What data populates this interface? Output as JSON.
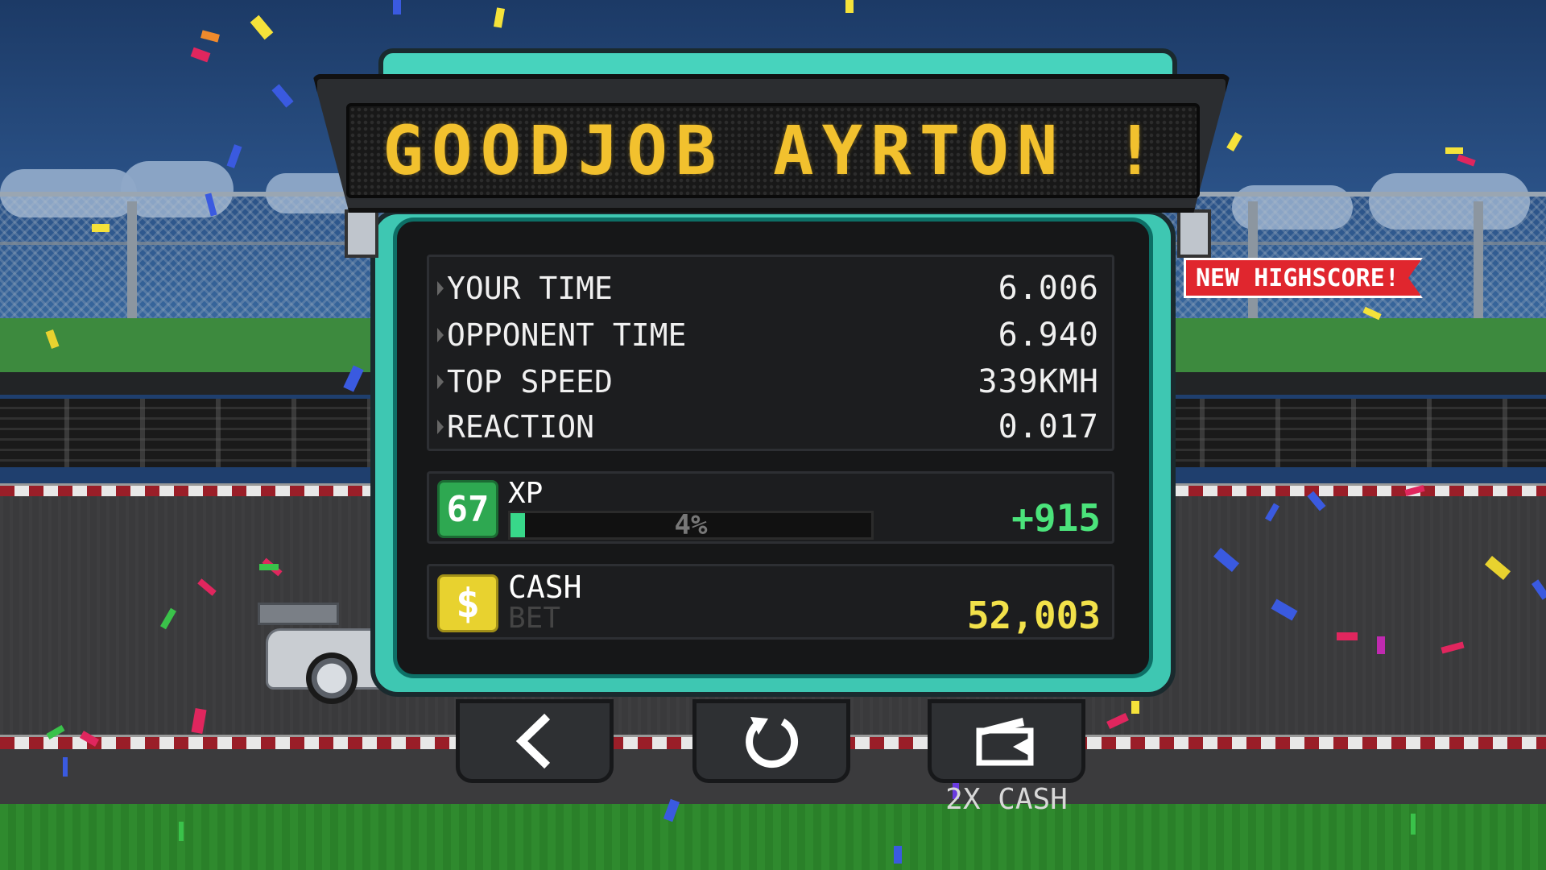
{
  "header": {
    "title": "GOODJOB AYRTON !"
  },
  "badge": {
    "label": "NEW HIGHSCORE!"
  },
  "stats": [
    {
      "label": "YOUR TIME",
      "value": "6.006"
    },
    {
      "label": "OPPONENT TIME",
      "value": "6.940"
    },
    {
      "label": "TOP SPEED",
      "value": "339KMH"
    },
    {
      "label": "REACTION",
      "value": "0.017"
    }
  ],
  "xp": {
    "level": "67",
    "label": "XP",
    "progress_percent": 4,
    "progress_text": "4%",
    "gain": "+915"
  },
  "cash": {
    "icon": "$",
    "label": "CASH",
    "sublabel": "BET",
    "value": "52,003"
  },
  "buttons": {
    "back_icon": "back-arrow-icon",
    "retry_icon": "retry-icon",
    "video_icon": "video-camera-icon",
    "video_caption": "2X CASH"
  },
  "colors": {
    "panel_teal": "#3ec7b2",
    "board_text": "#f2c12e",
    "xp_green": "#38d88a",
    "cash_yellow": "#f2e14a",
    "badge_red": "#e0262e"
  }
}
